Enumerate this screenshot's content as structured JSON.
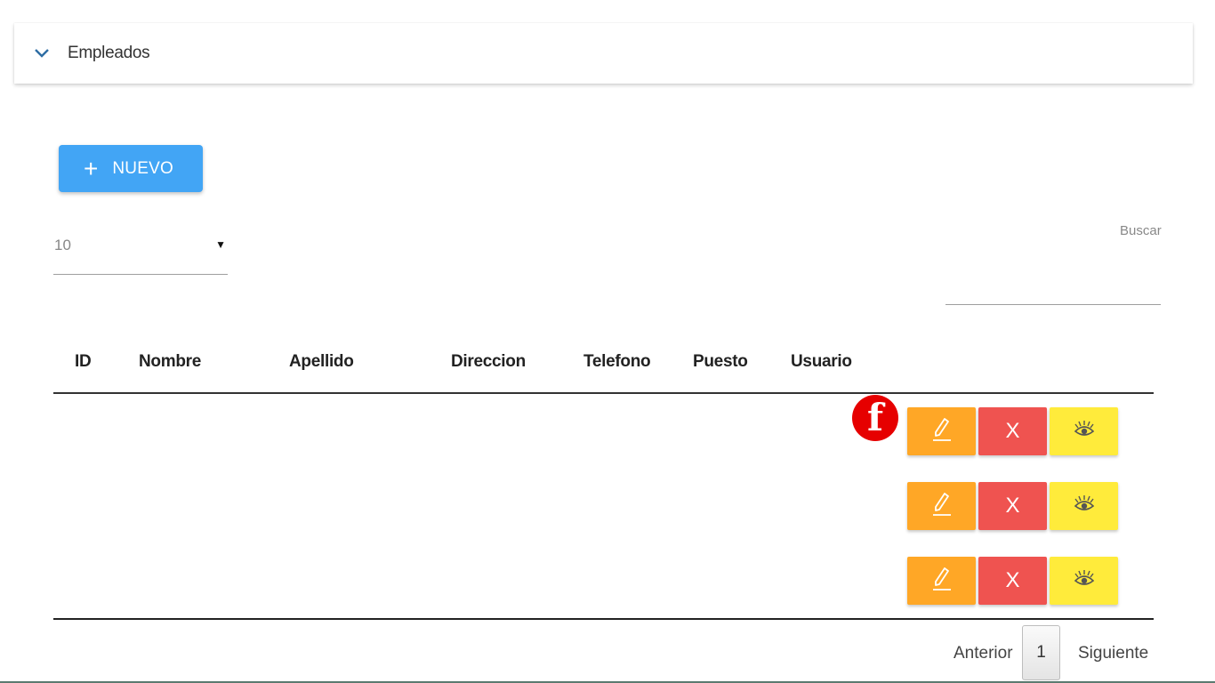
{
  "panel": {
    "title": "Empleados",
    "toggle_icon": "chevron-down-icon"
  },
  "toolbar": {
    "new_label": "NUEVO",
    "new_icon": "plus-icon"
  },
  "page_size": {
    "value": "10",
    "arrow": "▾"
  },
  "search": {
    "label": "Buscar",
    "value": ""
  },
  "table": {
    "columns": [
      "ID",
      "Nombre",
      "Apellido",
      "Direccion",
      "Telefono",
      "Puesto",
      "Usuario"
    ],
    "rows": [
      {
        "delete_label": "X"
      },
      {
        "delete_label": "X"
      },
      {
        "delete_label": "X"
      }
    ]
  },
  "badge": {
    "letter": "f",
    "color": "#e60000"
  },
  "pagination": {
    "prev": "Anterior",
    "current": "1",
    "next": "Siguiente"
  },
  "colors": {
    "primary": "#42a5f5",
    "edit": "#ffa726",
    "delete": "#ef5350",
    "view": "#ffeb3b"
  }
}
